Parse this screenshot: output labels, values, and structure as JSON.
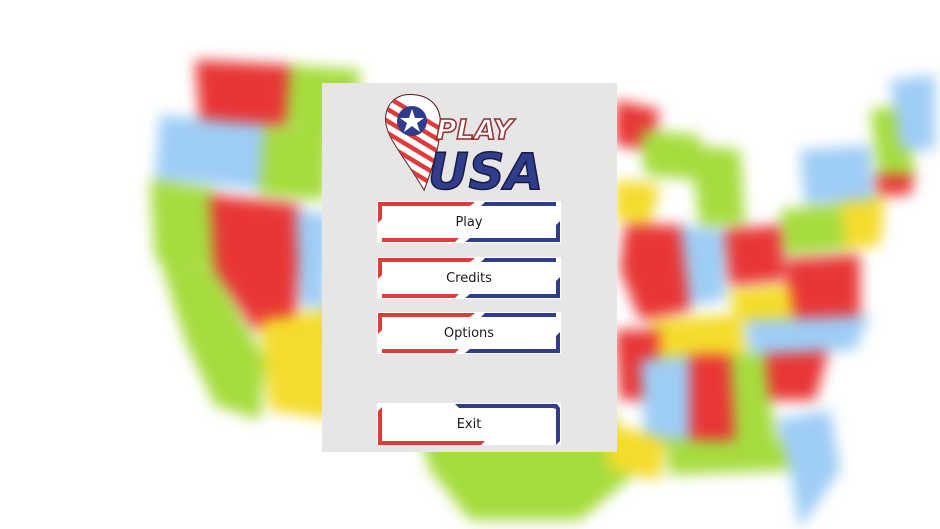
{
  "logo": {
    "line1": "PLAY",
    "line2": "USA"
  },
  "menu": {
    "play_label": "Play",
    "credits_label": "Credits",
    "options_label": "Options",
    "exit_label": "Exit"
  },
  "colors": {
    "red": "#e03a3a",
    "blue": "#2f3d8c",
    "panel": "#e6e6e6",
    "map_red": "#e83636",
    "map_green": "#a6dc3e",
    "map_blue": "#9ecdf5",
    "map_yellow": "#f4dc2c"
  }
}
